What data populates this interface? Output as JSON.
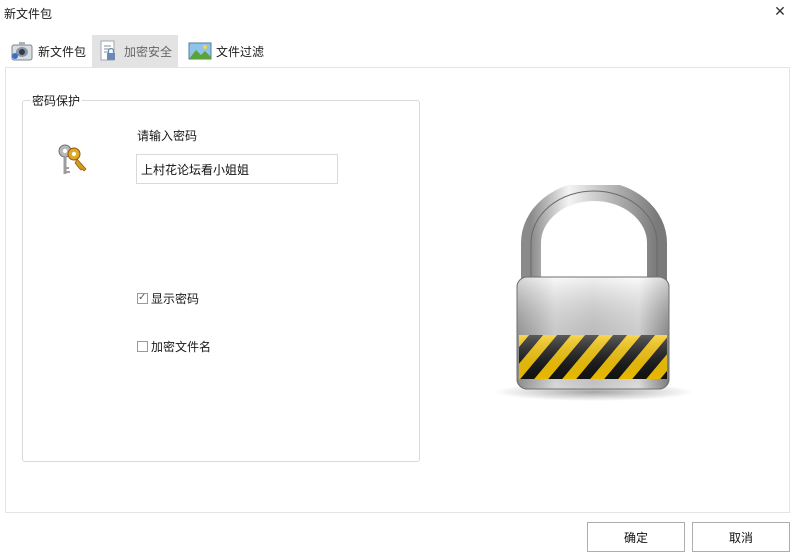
{
  "window": {
    "title": "新文件包"
  },
  "tabs": [
    {
      "label": "新文件包",
      "icon": "package-icon"
    },
    {
      "label": "加密安全",
      "icon": "document-lock-icon"
    },
    {
      "label": "文件过滤",
      "icon": "landscape-filter-icon"
    }
  ],
  "password_group": {
    "title": "密码保护",
    "prompt": "请输入密码",
    "password_value": "上村花论坛看小姐姐",
    "show_password": {
      "label": "显示密码",
      "checked": true
    },
    "encrypt_filename": {
      "label": "加密文件名",
      "checked": false
    }
  },
  "buttons": {
    "ok": "确定",
    "cancel": "取消"
  },
  "colors": {
    "accent_tab_bg": "#e3e3e3",
    "stripe_yellow": "#f5c400",
    "stripe_black": "#141414"
  }
}
